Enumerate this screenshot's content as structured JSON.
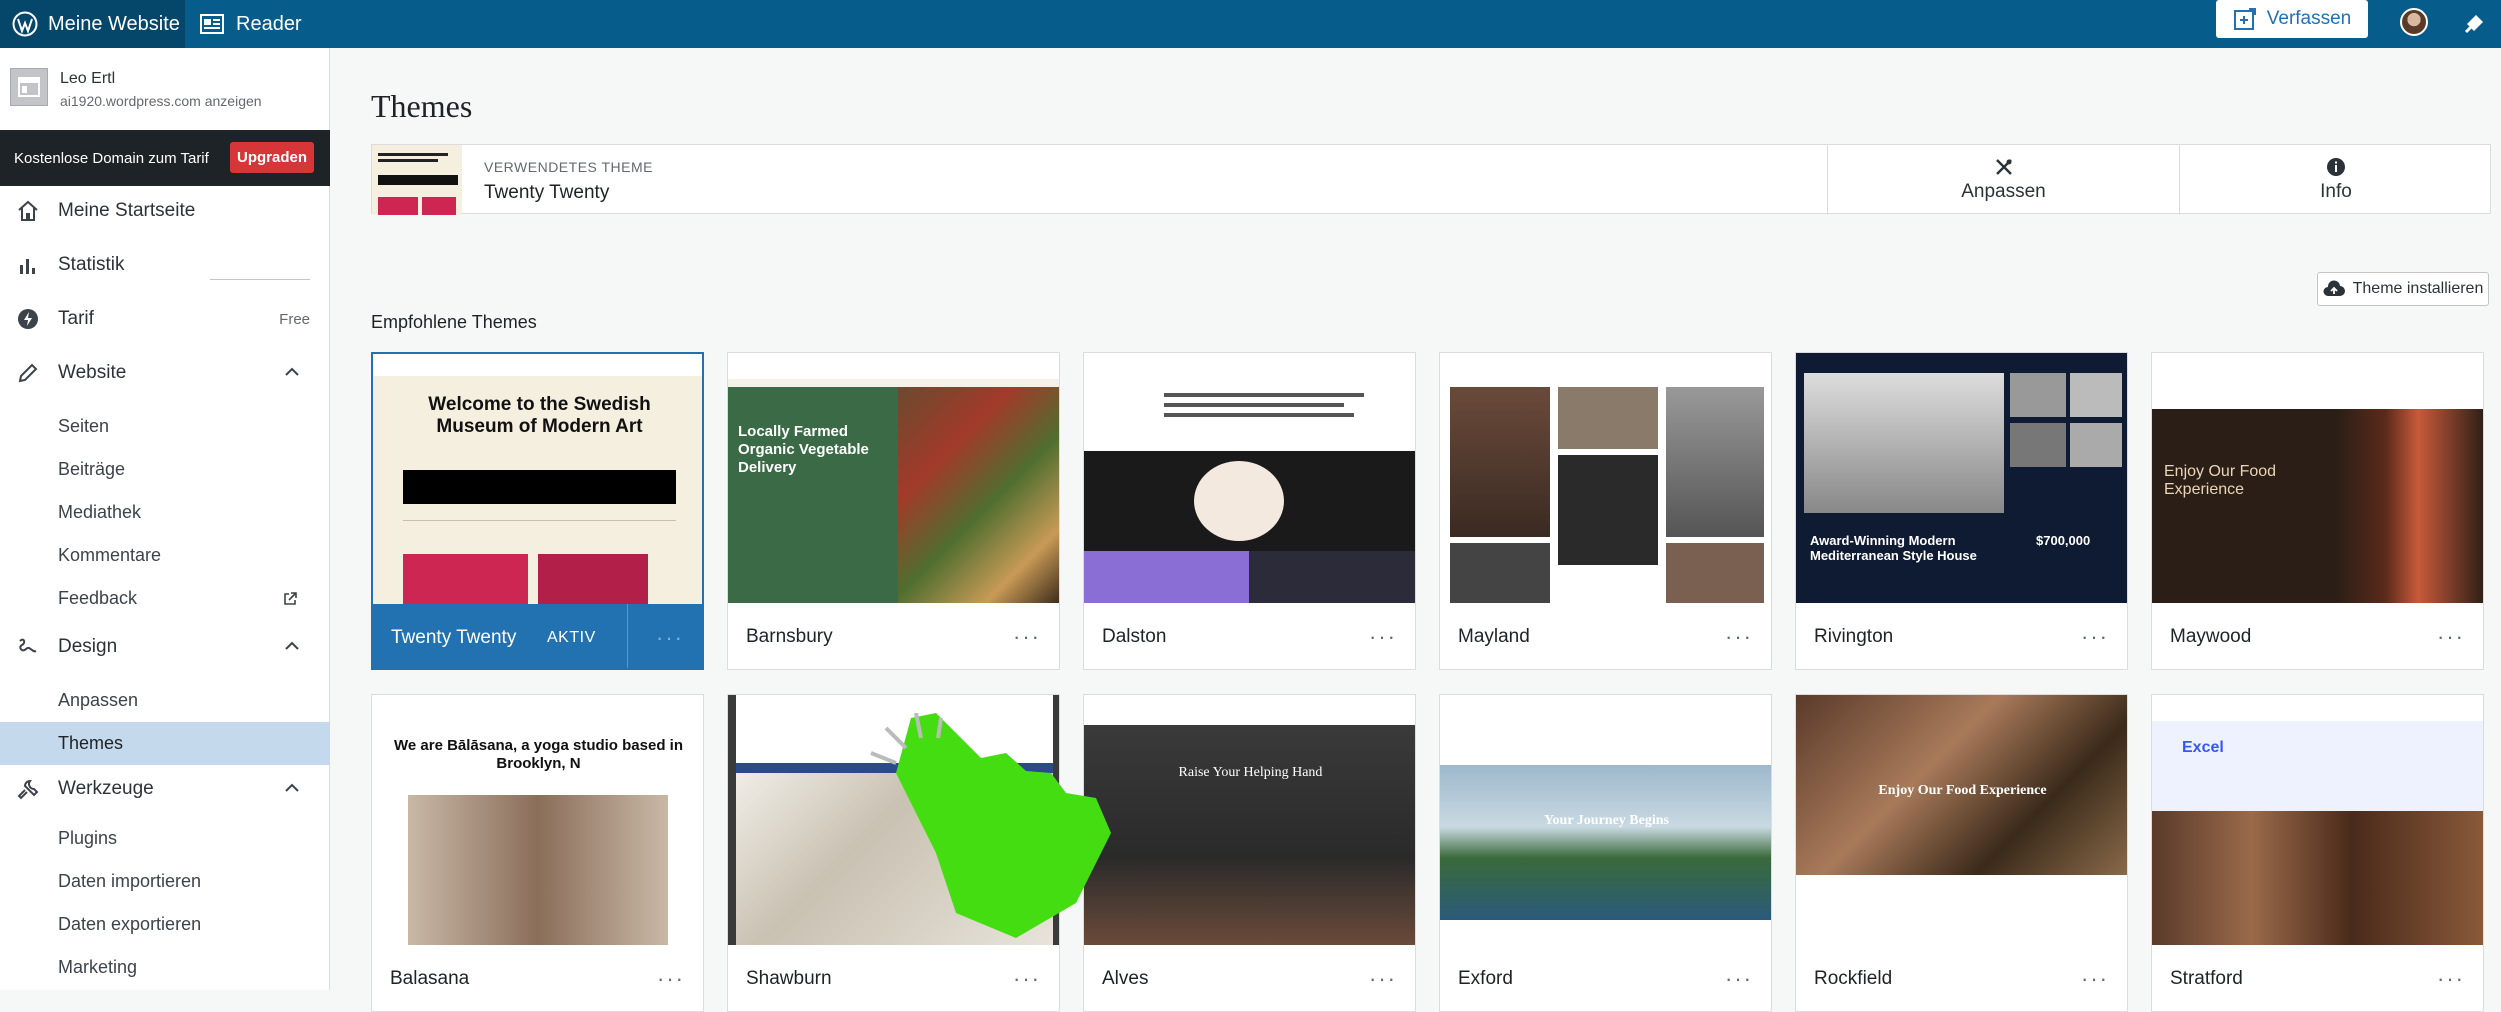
{
  "topbar": {
    "site_label": "Meine Website",
    "reader_label": "Reader",
    "compose_label": "Verfassen"
  },
  "sidebar": {
    "user_name": "Leo Ertl",
    "site_url": "ai1920.wordpress.com anzeigen",
    "upsell_text": "Kostenlose Domain zum Tarif",
    "upsell_button": "Upgraden",
    "items": [
      {
        "label": "Meine Startseite",
        "icon": "home-icon"
      },
      {
        "label": "Statistik",
        "icon": "stats-icon"
      },
      {
        "label": "Tarif",
        "icon": "plan-icon",
        "badge": "Free"
      },
      {
        "label": "Website",
        "icon": "pencil-icon"
      },
      {
        "label": "Design",
        "icon": "design-icon"
      },
      {
        "label": "Werkzeuge",
        "icon": "wrench-icon"
      }
    ],
    "website_sub": [
      "Seiten",
      "Beiträge",
      "Mediathek",
      "Kommentare",
      "Feedback"
    ],
    "design_sub": [
      "Anpassen",
      "Themes"
    ],
    "tools_sub": [
      "Plugins",
      "Daten importieren",
      "Daten exportieren",
      "Marketing"
    ]
  },
  "main": {
    "title": "Themes",
    "current_label": "VERWENDETES THEME",
    "current_name": "Twenty Twenty",
    "customize_label": "Anpassen",
    "info_label": "Info",
    "install_label": "Theme installieren",
    "section_title": "Empfohlene Themes",
    "active_label": "AKTIV",
    "more_label": "···",
    "themes": [
      {
        "name": "Twenty Twenty",
        "headline": "Welcome to the Swedish Museum of Modern Art"
      },
      {
        "name": "Barnsbury",
        "headline": "Locally Farmed Organic Vegetable Delivery"
      },
      {
        "name": "Dalston",
        "headline": ""
      },
      {
        "name": "Mayland",
        "headline": ""
      },
      {
        "name": "Rivington",
        "headline": "Award-Winning Modern Mediterranean Style House",
        "price": "$700,000"
      },
      {
        "name": "Maywood",
        "headline": "Enjoy Our Food Experience"
      },
      {
        "name": "Balasana",
        "headline": "We are Bālāsana, a yoga studio based in Brooklyn, N"
      },
      {
        "name": "Shawburn",
        "headline": ""
      },
      {
        "name": "Alves",
        "headline": "Raise Your Helping Hand"
      },
      {
        "name": "Exford",
        "headline": "Your Journey Begins"
      },
      {
        "name": "Rockfield",
        "headline": "Enjoy Our Food Experience"
      },
      {
        "name": "Stratford",
        "headline": "Excel"
      }
    ]
  },
  "colors": {
    "topbar": "#065c8a",
    "accent": "#2271b1",
    "upgrade": "#d63638",
    "cursor": "#44dd11"
  }
}
